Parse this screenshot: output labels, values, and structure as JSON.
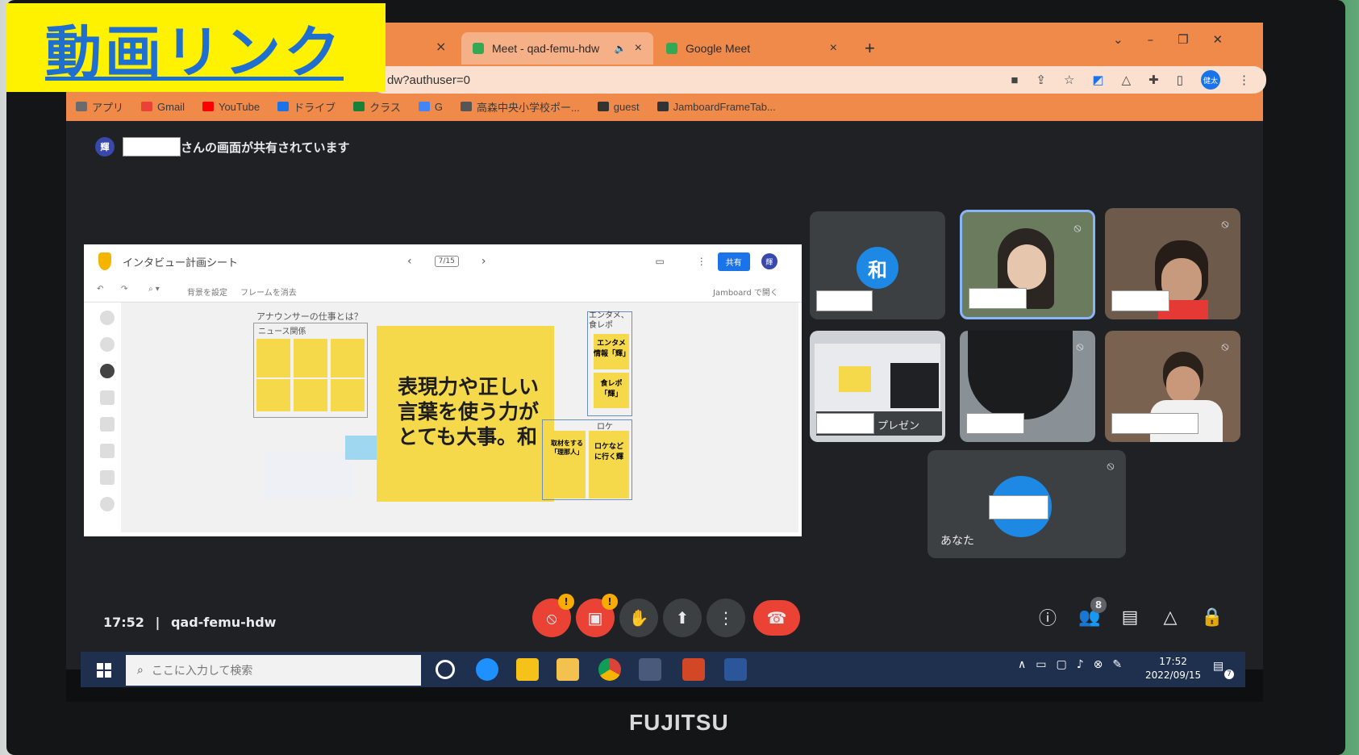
{
  "overlay_label": "動画リンク",
  "browser": {
    "tabs": [
      {
        "label": "Meet - qad-femu-hdw",
        "icon": "meet-icon",
        "sound_icon": "🔈",
        "close": "×"
      },
      {
        "label": "Google Meet",
        "icon": "meet-icon",
        "close": "×"
      }
    ],
    "first_tab_close": "×",
    "new_tab": "+",
    "address_fragment": "dw?authuser=0",
    "window_controls": [
      "⌄",
      "–",
      "❐",
      "✕"
    ],
    "profile_initials": "健太",
    "bookmarks": [
      {
        "label": "アプリ",
        "color": "#6b6b6b"
      },
      {
        "label": "Gmail",
        "color": "#ea4335"
      },
      {
        "label": "YouTube",
        "color": "#ff0000"
      },
      {
        "label": "ドライブ",
        "color": "#1a73e8"
      },
      {
        "label": "クラス",
        "color": "#188038"
      },
      {
        "label": "G",
        "color": "#4285f4"
      },
      {
        "label": "高森中央小学校ポー...",
        "color": "#555555"
      },
      {
        "label": "guest",
        "color": "#333333"
      },
      {
        "label": "JamboardFrameTab...",
        "color": "#333333"
      }
    ]
  },
  "meet": {
    "share_banner": "さんの画面が共有されています",
    "presenter_initial": "輝",
    "jamboard": {
      "title": "インタビュー計画シート",
      "frame_counter": "7/15",
      "share_button": "共有",
      "user_initial": "輝",
      "toolbar": {
        "set_bg": "背景を設定",
        "clear_frame": "フレームを消去",
        "open": "Jamboard で開く"
      },
      "heading_announcer": "アナウンサーの仕事とは？",
      "news_section": "ニュース関係",
      "entertainment_section": "エンタメ、食レポ",
      "location_section": "ロケ",
      "main_note": "表現力や正しい言葉を使う力がとても大事。和",
      "small_notes": [
        "エンタメ情報「輝」",
        "食レポ「輝」",
        "ロケなどに行く輝",
        "取材をする「理那人」"
      ]
    },
    "tiles": [
      {
        "kind": "avatar",
        "initial": "和"
      },
      {
        "kind": "video"
      },
      {
        "kind": "video"
      },
      {
        "kind": "screen",
        "caption": "プレゼン"
      },
      {
        "kind": "video"
      },
      {
        "kind": "video"
      },
      {
        "kind": "self",
        "caption": "あなた"
      }
    ],
    "clock": "17:52",
    "meeting_code": "qad-femu-hdw",
    "controls": {
      "alert": "!",
      "participants_count": "8"
    }
  },
  "taskbar": {
    "search_placeholder": "ここに入力して検索",
    "time": "17:52",
    "date": "2022/09/15",
    "notification_count": "7"
  },
  "brand": "FUJITSU",
  "colors": {
    "chrome_orange": "#f08a4a",
    "meet_bg": "#202124",
    "sticky_yellow": "#f5d94a",
    "end_call_red": "#ea4335",
    "overlay_yellow": "#fff200",
    "overlay_blue": "#1f6fd1"
  }
}
